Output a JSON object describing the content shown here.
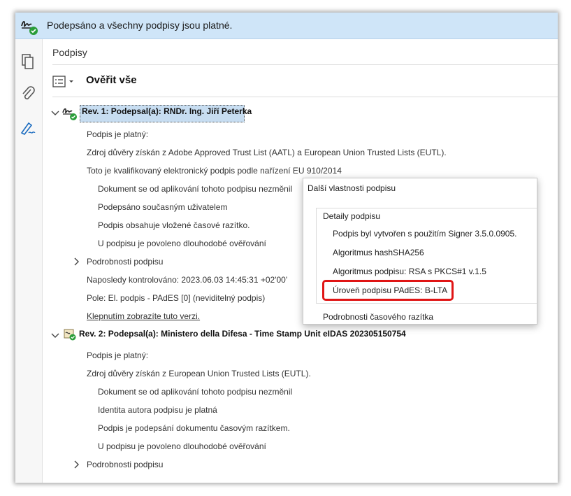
{
  "banner": {
    "text": "Podepsáno a všechny podpisy jsou platné.",
    "icon": "signature-valid-icon"
  },
  "sidebar": {
    "icons": [
      "pages-icon",
      "attachment-icon",
      "signature-pen-icon"
    ]
  },
  "panel": {
    "title": "Podpisy",
    "verify_all": "Ověřit vše",
    "rev1": {
      "heading": "Rev. 1: Podepsal(a): RNDr. Ing. Jiří Peterka",
      "valid": "Podpis je platný:",
      "trust": "Zdroj důvěry získán z Adobe Approved Trust List (AATL) a European Union Trusted Lists (EUTL).",
      "qualified": "Toto je kvalifikovaný elektronický podpis podle nařízení EU 910/2014",
      "sub": [
        "Dokument se od aplikování tohoto podpisu nezměnil",
        "Podepsáno současným uživatelem",
        "Podpis obsahuje vložené časové razítko.",
        "U podpisu je povoleno dlouhodobé ověřování"
      ],
      "details": "Podrobnosti podpisu",
      "last_checked": "Naposledy kontrolováno: 2023.06.03 14:45:31 +02'00'",
      "field": "Pole: El. podpis - PAdES [0] (neviditelný podpis)",
      "click_link": "Klepnutím zobrazíte tuto verzi."
    },
    "rev2": {
      "heading": "Rev. 2: Podepsal(a): Ministero della Difesa - Time Stamp Unit eIDAS 202305150754",
      "valid": "Podpis je platný:",
      "trust": "Zdroj důvěry získán z European Union Trusted Lists (EUTL).",
      "sub": [
        "Dokument se od aplikování tohoto podpisu nezměnil",
        "Identita autora podpisu je platná",
        "Podpis je podepsání dokumentu časovým razítkem.",
        "U podpisu je povoleno dlouhodobé ověřování"
      ],
      "details": "Podrobnosti podpisu"
    }
  },
  "popup": {
    "title": "Další vlastnosti podpisu",
    "group_label": "Detaily podpisu",
    "items": [
      "Podpis byl vytvořen s použitím Signer 3.5.0.0905.",
      "Algoritmus hashSHA256",
      "Algoritmus podpisu: RSA s PKCS#1 v.1.5",
      "Úroveň podpisu PAdES: B-LTA"
    ],
    "next_group": "Podrobnosti časového razítka"
  },
  "colors": {
    "banner_bg": "#cfe5f8",
    "selection": "#c7ddf1",
    "highlight": "#e01515",
    "valid_green": "#2a9d3a"
  }
}
